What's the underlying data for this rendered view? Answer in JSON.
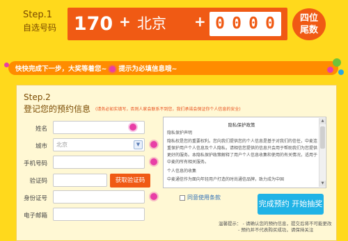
{
  "step1": {
    "label": "Step.1",
    "title": "自选号码",
    "prefix": "170",
    "plus": "+",
    "city": "北京",
    "digits": [
      "0",
      "0",
      "0",
      "0"
    ],
    "tail_badge_line1": "四位",
    "tail_badge_line2": "尾数"
  },
  "hint": {
    "text_before": "快快完成下一步，大奖等着您~",
    "text_after": "提示为必填信息哦~"
  },
  "step2": {
    "label": "Step.2",
    "title": "登记您的预约信息",
    "note": "(请务必如实填写，否则人家会联系不到您，我们承诺会保证你个人信息的安全)"
  },
  "form": {
    "name_label": "姓名",
    "city_label": "城市",
    "city_value": "北京",
    "phone_label": "手机号码",
    "code_label": "验证码",
    "code_button": "获取验证码",
    "id_label": "身份证号",
    "email_label": "电子邮箱"
  },
  "privacy": {
    "title": "隐私保护政策",
    "heading": "隐私保护声明",
    "p1": "隐私权是您的重要权利。您向我们提供您的个人信息是基于对我们的信任，中麦连重保护用户个人信息及个人隐私，请相信您提供的信息只会用于帮助我们为您提供更好的服务。本隐私保护政策解释了用户个人信息收集和使用的有关情况，适用于中麦的所有相关服务。",
    "section": "个人信息的收集",
    "p2": "中麦通信作为面向年轻用户打造的时尚通信品牌，致力成为中国"
  },
  "agree_label": "同意使用条款",
  "submit_label": "完成预约 开始抽奖",
  "tips": {
    "line1": "温馨提示：  - 请确认您的预约信息，提交后将不可能更改",
    "line2": "- 预约并不代表购买成功，请保持关注"
  },
  "colors": {
    "background": "#ffd91c",
    "accent_orange": "#f05a14",
    "submit_blue": "#20b3e6",
    "required_pink": "#e83ea6"
  }
}
